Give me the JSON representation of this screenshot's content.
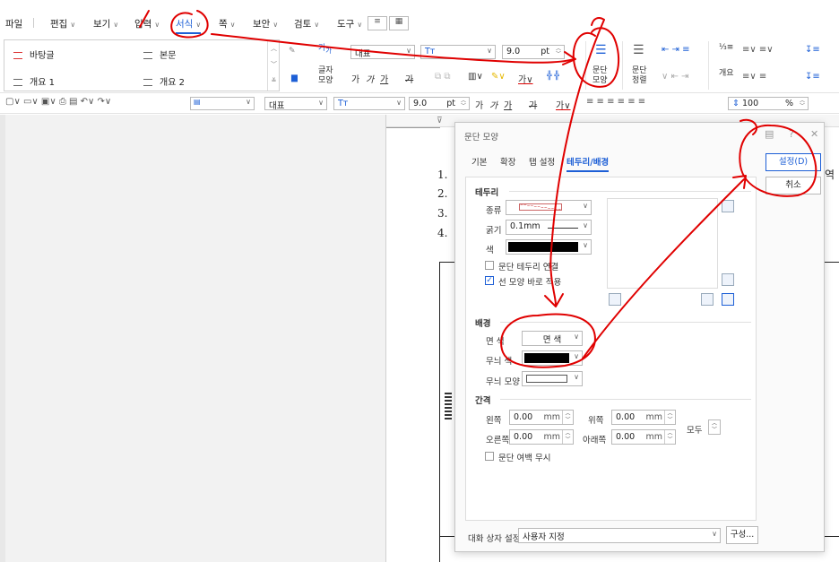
{
  "menu": [
    {
      "label": "파일",
      "caret": false
    },
    {
      "label": "편집",
      "caret": true
    },
    {
      "label": "보기",
      "caret": true
    },
    {
      "label": "입력",
      "caret": true
    },
    {
      "label": "서식",
      "caret": true,
      "active": true
    },
    {
      "label": "쪽",
      "caret": true
    },
    {
      "label": "보안",
      "caret": true
    },
    {
      "label": "검토",
      "caret": true
    },
    {
      "label": "도구",
      "caret": true
    }
  ],
  "styles": {
    "items": [
      "바탕글",
      "본문",
      "개요 1",
      "개요 2"
    ]
  },
  "ribbon": {
    "char_shape_label": "글자\n모양",
    "char_shape_small": "가",
    "font_style_value": "대표",
    "font_name_value": "Tт",
    "font_size_value": "9.0",
    "font_size_unit": "pt",
    "para_shape_label": "문단\n모양",
    "para_align_label": "문단\n정렬",
    "outline_label": "개요",
    "bold": "가",
    "italic": "가",
    "underline": "가",
    "strike": "가"
  },
  "toolbar2": {
    "font_style_value": "대표",
    "font_name_value": "Tт",
    "font_size_value": "9.0",
    "font_size_unit": "pt",
    "bold": "가",
    "italic": "가",
    "underline": "가",
    "strike": "가",
    "line_spacing": "100",
    "line_spacing_unit": "%"
  },
  "document": {
    "numbers": [
      "1.",
      "2.",
      "3.",
      "4."
    ],
    "side_char": "역"
  },
  "dialog": {
    "title": "문단 모양",
    "tabs": [
      "기본",
      "확장",
      "탭 설정",
      "테두리/배경"
    ],
    "active_tab": "테두리/배경",
    "set_button": "설정(D)",
    "cancel_button": "취소",
    "border_section": "테두리",
    "type_label": "종류",
    "width_label": "굵기",
    "width_value": "0.1mm",
    "color_label": "색",
    "connect_label": "문단 테두리 연결",
    "apply_line_label": "선 모양 바로 적용",
    "bg_section": "배경",
    "face_color_label": "면 색",
    "face_color_value": "면 색",
    "pattern_color_label": "무늬 색",
    "pattern_shape_label": "무늬 모양",
    "spacing_section": "간격",
    "left_label": "왼쪽",
    "left_value": "0.00",
    "left_unit": "mm",
    "top_label": "위쪽",
    "top_value": "0.00",
    "top_unit": "mm",
    "right_label": "오른쪽",
    "right_value": "0.00",
    "right_unit": "mm",
    "bottom_label": "아래쪽",
    "bottom_value": "0.00",
    "bottom_unit": "mm",
    "all_label": "모두",
    "ignore_margin_label": "문단 여백 무시",
    "dialog_setting_label": "대화 상자 설정",
    "dialog_setting_value": "사용자 지정",
    "compose_button": "구성..."
  },
  "colors": {
    "accent": "#1d5fd6",
    "annotation": "#e00000"
  }
}
